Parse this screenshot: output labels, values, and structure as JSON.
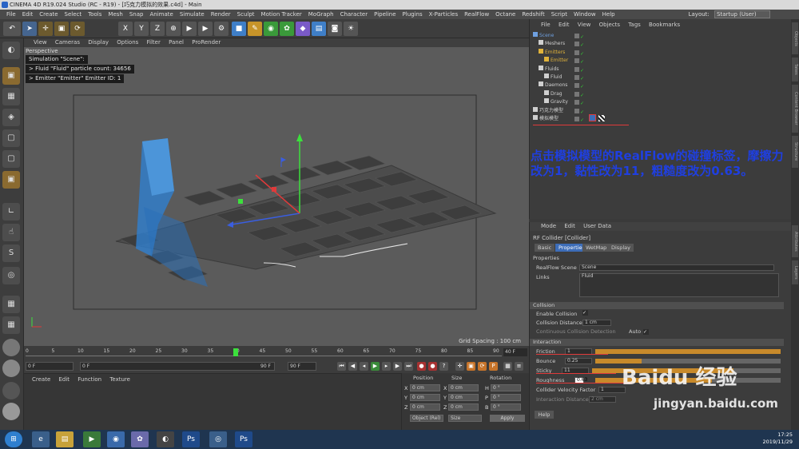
{
  "window": {
    "title": "CINEMA 4D R19.024 Studio (RC - R19) - [巧克力模拟的效果.c4d] - Main"
  },
  "menubar": [
    "File",
    "Edit",
    "Create",
    "Select",
    "Tools",
    "Mesh",
    "Snap",
    "Animate",
    "Simulate",
    "Render",
    "Sculpt",
    "Motion Tracker",
    "MoGraph",
    "Character",
    "Pipeline",
    "Plugins",
    "X-Particles",
    "RealFlow",
    "Octane",
    "Redshift",
    "Script",
    "Window",
    "Help"
  ],
  "layout": {
    "label": "Layout:",
    "value": "Startup (User)"
  },
  "toolbar_icons": [
    "undo-icon",
    "move-icon",
    "scale-icon",
    "rotate-icon",
    "live-select-icon",
    "x-axis-icon",
    "y-axis-icon",
    "z-axis-icon",
    "coordinate-system-icon",
    "render-view-icon",
    "render-picture-viewer-icon",
    "render-settings-icon",
    "cube-icon",
    "pen-icon",
    "subdivision-icon",
    "array-icon",
    "deformer-icon",
    "scene-icon",
    "camera-icon",
    "light-icon"
  ],
  "toolbar_axis": [
    "X",
    "Y",
    "Z"
  ],
  "viewport": {
    "menu": [
      "View",
      "Cameras",
      "Display",
      "Options",
      "Filter",
      "Panel",
      "ProRender"
    ],
    "label": "Perspective",
    "hud": [
      "Simulation \"Scene\":",
      "> Fluid \"Fluid\" particle count: 34656",
      "> Emitter \"Emitter\" Emitter ID: 1"
    ],
    "grid_spacing": "Grid Spacing : 100 cm"
  },
  "timeline": {
    "ticks": [
      "0",
      "5",
      "10",
      "15",
      "20",
      "25",
      "30",
      "35",
      "40",
      "45",
      "50",
      "55",
      "60",
      "65",
      "70",
      "75",
      "80",
      "85",
      "90"
    ],
    "current_frame": "40 F",
    "start": "0 F",
    "field2": "0 F",
    "end_min": "90 F",
    "end": "90 F"
  },
  "material_manager": {
    "menu": [
      "Create",
      "Edit",
      "Function",
      "Texture"
    ]
  },
  "coordinates": {
    "headers": [
      "Position",
      "Size",
      "Rotation"
    ],
    "rows": [
      {
        "axis": "X",
        "pos": "0 cm",
        "size": "0 cm",
        "rot_label": "H",
        "rot": "0 °"
      },
      {
        "axis": "Y",
        "pos": "0 cm",
        "size": "0 cm",
        "rot_label": "P",
        "rot": "0 °"
      },
      {
        "axis": "Z",
        "pos": "0 cm",
        "size": "0 cm",
        "rot_label": "B",
        "rot": "0 °"
      }
    ],
    "mode": "Object (Rel)",
    "size_mode": "Size",
    "apply": "Apply"
  },
  "object_manager": {
    "menu": [
      "File",
      "Edit",
      "View",
      "Objects",
      "Tags",
      "Bookmarks"
    ],
    "tree": [
      {
        "name": "Scene",
        "indent": 0,
        "color": "#6fa0e0"
      },
      {
        "name": "Meshers",
        "indent": 1,
        "color": "#cfcfcf"
      },
      {
        "name": "Emitters",
        "indent": 1,
        "color": "#e0b23a"
      },
      {
        "name": "Emitter",
        "indent": 2,
        "color": "#e0b23a"
      },
      {
        "name": "Fluids",
        "indent": 1,
        "color": "#cfcfcf"
      },
      {
        "name": "Fluid",
        "indent": 2,
        "color": "#cfcfcf"
      },
      {
        "name": "Daemons",
        "indent": 1,
        "color": "#cfcfcf"
      },
      {
        "name": "Drag",
        "indent": 2,
        "color": "#cfcfcf"
      },
      {
        "name": "Gravity",
        "indent": 2,
        "color": "#cfcfcf"
      },
      {
        "name": "巧克力模型",
        "indent": 0,
        "color": "#cfcfcf"
      },
      {
        "name": "模拟模型",
        "indent": 0,
        "color": "#cfcfcf"
      }
    ]
  },
  "annotation": "点击模拟模型的RealFlow的碰撞标签，摩擦力改为1，黏性改为11，粗糙度改为0.63。",
  "attributes": {
    "menu": [
      "Mode",
      "Edit",
      "User Data"
    ],
    "title": "RF Collider [Collider]",
    "tabs": [
      "Basic",
      "Properties",
      "WetMap",
      "Display"
    ],
    "active_tab": "Properties",
    "properties_header": "Properties",
    "realflow_scene_label": "RealFlow Scene",
    "realflow_scene_value": "Scene",
    "links_label": "Links",
    "links_value": "Fluid",
    "collision_header": "Collision",
    "enable_collision": "Enable Collision",
    "collision_distance_label": "Collision Distance",
    "collision_distance": "1 cm",
    "continuous_label": "Continuous Collision Detection",
    "auto_label": "Auto",
    "interaction_header": "Interaction",
    "friction_label": "Friction",
    "friction": "1",
    "friction_fill": 1.0,
    "bounce_label": "Bounce",
    "bounce": "0.25",
    "bounce_fill": 0.25,
    "sticky_label": "Sticky",
    "sticky": "11",
    "sticky_fill": 0.75,
    "roughness_label": "Roughness",
    "roughness": "0.63",
    "roughness_fill": 0.63,
    "velocity_label": "Collider Velocity Factor",
    "velocity": "1",
    "interaction_distance_label": "Interaction Distance",
    "interaction_distance": "2 cm",
    "help": "Help"
  },
  "right_tabs": [
    "Objects",
    "Takes",
    "Content Browser",
    "Structure",
    "Attributes",
    "Layers"
  ],
  "taskbar": {
    "time": "17:25",
    "date": "2019/11/29"
  },
  "watermark": {
    "text": "Baidu 经验",
    "url": "jingyan.baidu.com"
  }
}
